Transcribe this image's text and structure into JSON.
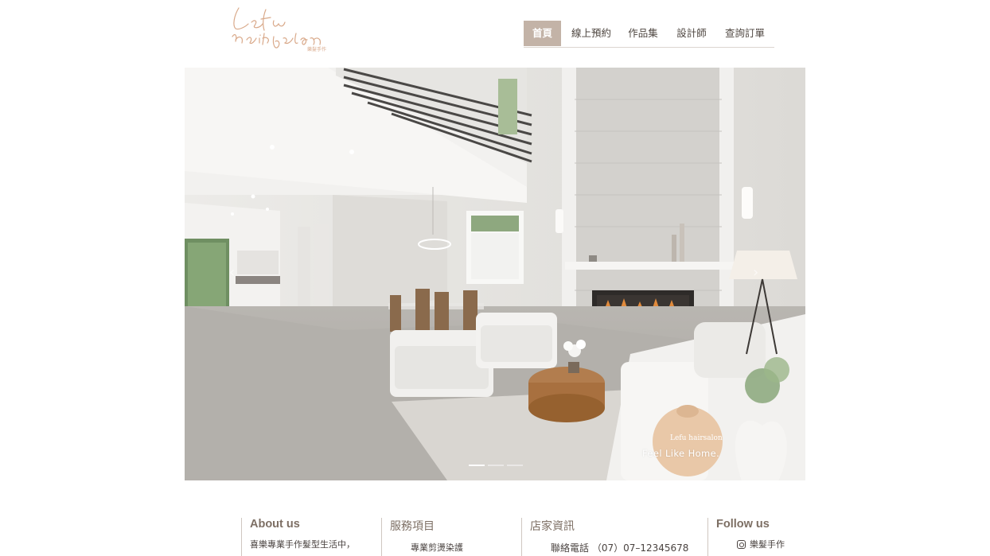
{
  "brand": {
    "logo_script": "Lefu hairsalon",
    "logo_cn": "樂髮手作"
  },
  "nav": {
    "items": [
      {
        "label": "首頁",
        "active": true
      },
      {
        "label": "線上預約",
        "active": false
      },
      {
        "label": "作品集",
        "active": false
      },
      {
        "label": "設計師",
        "active": false
      },
      {
        "label": "查詢訂單",
        "active": false
      }
    ]
  },
  "hero": {
    "tagline": "Feel Like Home.",
    "slide_count": 3,
    "active_slide": 1
  },
  "footer": {
    "about": {
      "title": "About us",
      "text": "喜樂專業手作髮型生活中，"
    },
    "services": {
      "title": "服務項目",
      "text": "專業剪燙染護"
    },
    "store": {
      "title": "店家資訊",
      "text": "聯絡電話 （07）07–12345678"
    },
    "follow": {
      "title": "Follow us",
      "text": "樂髮手作",
      "icon": "instagram-icon"
    }
  },
  "colors": {
    "nav_active_bg": "#c3b3a7",
    "accent_logo": "#d9a98a"
  }
}
